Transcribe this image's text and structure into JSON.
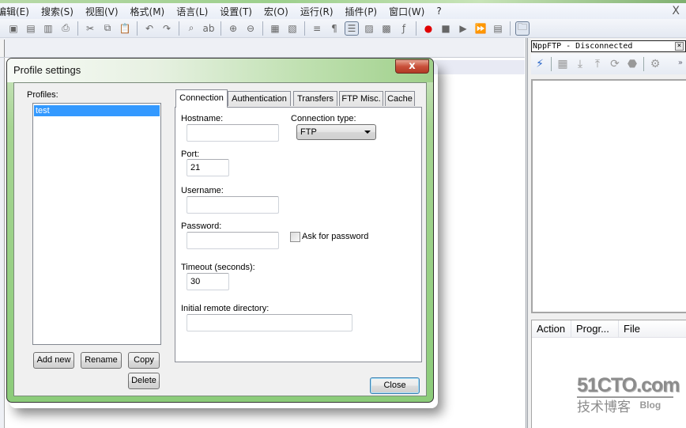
{
  "app": {
    "menu": [
      "编辑(E)",
      "搜索(S)",
      "视图(V)",
      "格式(M)",
      "语言(L)",
      "设置(T)",
      "宏(O)",
      "运行(R)",
      "插件(P)",
      "窗口(W)",
      "?"
    ],
    "menu_close_glyph": "X",
    "toolbar_icons": [
      {
        "name": "save-all-icon",
        "glyph": "▣"
      },
      {
        "name": "close-file-icon",
        "glyph": "▤"
      },
      {
        "name": "close-all-icon",
        "glyph": "▥"
      },
      {
        "name": "print-icon",
        "glyph": "⎙"
      },
      {
        "sep": true
      },
      {
        "name": "cut-icon",
        "glyph": "✂"
      },
      {
        "name": "copy-icon",
        "glyph": "⧉"
      },
      {
        "name": "paste-icon",
        "glyph": "📋"
      },
      {
        "sep": true
      },
      {
        "name": "undo-icon",
        "glyph": "↶"
      },
      {
        "name": "redo-icon",
        "glyph": "↷"
      },
      {
        "sep": true
      },
      {
        "name": "find-icon",
        "glyph": "⌕"
      },
      {
        "name": "replace-icon",
        "glyph": "ab"
      },
      {
        "sep": true
      },
      {
        "name": "zoom-in-icon",
        "glyph": "⊕"
      },
      {
        "name": "zoom-out-icon",
        "glyph": "⊖"
      },
      {
        "sep": true
      },
      {
        "name": "sync-vertical-icon",
        "glyph": "▦"
      },
      {
        "name": "sync-horizontal-icon",
        "glyph": "▧"
      },
      {
        "sep": true
      },
      {
        "name": "word-wrap-icon",
        "glyph": "≡"
      },
      {
        "name": "show-all-chars-icon",
        "glyph": "¶"
      },
      {
        "name": "indent-guide-icon",
        "glyph": "☰",
        "active": true
      },
      {
        "name": "user-language-icon",
        "glyph": "▨"
      },
      {
        "name": "document-map-icon",
        "glyph": "▩"
      },
      {
        "name": "function-list-icon",
        "glyph": "ƒ"
      },
      {
        "sep": true
      },
      {
        "name": "record-macro-icon",
        "glyph": "●",
        "color": "#e00000"
      },
      {
        "name": "stop-macro-icon",
        "glyph": "■"
      },
      {
        "name": "play-macro-icon",
        "glyph": "▶"
      },
      {
        "name": "run-macro-multiple-icon",
        "glyph": "⏩",
        "color": "#2a5fd0"
      },
      {
        "name": "save-macro-icon",
        "glyph": "▤"
      },
      {
        "sep": true
      },
      {
        "name": "nppftp-show-icon",
        "glyph": "🗀",
        "active": true
      }
    ]
  },
  "ftp_panel": {
    "title": "NppFTP - Disconnected",
    "close_glyph": "×",
    "tools": [
      {
        "name": "connect-icon",
        "glyph": "⚡"
      },
      {
        "sep": true
      },
      {
        "name": "open-directory-icon",
        "glyph": "▦"
      },
      {
        "name": "download-icon",
        "glyph": "⤓"
      },
      {
        "name": "upload-icon",
        "glyph": "⤒"
      },
      {
        "name": "refresh-icon",
        "glyph": "⟳"
      },
      {
        "name": "abort-icon",
        "glyph": "⬣"
      },
      {
        "sep": true
      },
      {
        "name": "settings-icon",
        "glyph": "⚙"
      }
    ],
    "more_glyph": "»",
    "queue_columns": [
      "Action",
      "Progr...",
      "File"
    ]
  },
  "dialog": {
    "title": "Profile settings",
    "close_glyph": "x",
    "profiles_label": "Profiles:",
    "profiles": [
      {
        "name": "test",
        "selected": true
      }
    ],
    "buttons": {
      "add_new": "Add new",
      "rename": "Rename",
      "copy": "Copy",
      "delete": "Delete",
      "close": "Close"
    },
    "tabs": [
      {
        "label": "Connection",
        "active": true
      },
      {
        "label": "Authentication"
      },
      {
        "label": "Transfers"
      },
      {
        "label": "FTP Misc."
      },
      {
        "label": "Cache"
      }
    ],
    "connection": {
      "hostname_label": "Hostname:",
      "hostname_value": "",
      "connection_type_label": "Connection type:",
      "connection_type_value": "FTP",
      "port_label": "Port:",
      "port_value": "21",
      "username_label": "Username:",
      "username_value": "",
      "password_label": "Password:",
      "password_value": "",
      "ask_password_label": "Ask for password",
      "ask_password_checked": false,
      "timeout_label": "Timeout (seconds):",
      "timeout_value": "30",
      "initial_dir_label": "Initial remote directory:",
      "initial_dir_value": ""
    }
  },
  "watermark": {
    "main": "51CTO.com",
    "sub_cn": "技术博客",
    "sub_en": "Blog"
  }
}
